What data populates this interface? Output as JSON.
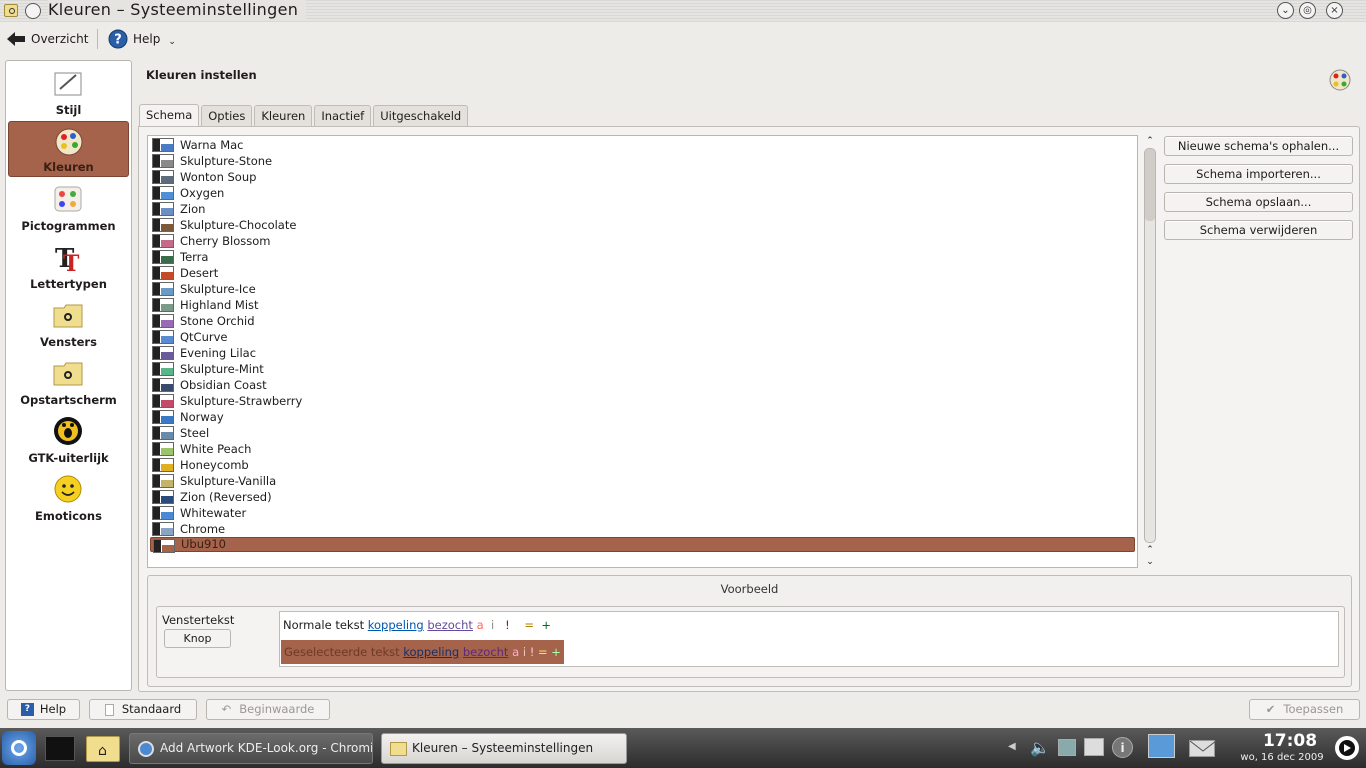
{
  "window": {
    "title": "Kleuren – Systeeminstellingen"
  },
  "toolbar": {
    "overview_label": "Overzicht",
    "help_label": "Help"
  },
  "sidebar": {
    "items": [
      {
        "label": "Stijl",
        "icon": "style-icon"
      },
      {
        "label": "Kleuren",
        "icon": "colors-icon"
      },
      {
        "label": "Pictogrammen",
        "icon": "icons-icon"
      },
      {
        "label": "Lettertypen",
        "icon": "fonts-icon"
      },
      {
        "label": "Vensters",
        "icon": "windows-folder-icon"
      },
      {
        "label": "Opstartscherm",
        "icon": "splash-folder-icon"
      },
      {
        "label": "GTK-uiterlijk",
        "icon": "gtk-icon"
      },
      {
        "label": "Emoticons",
        "icon": "emoticon-icon"
      }
    ],
    "selected": "Kleuren"
  },
  "main": {
    "title": "Kleuren instellen",
    "tabs": [
      "Schema",
      "Opties",
      "Kleuren",
      "Inactief",
      "Uitgeschakeld"
    ],
    "active_tab": "Schema",
    "schemes": [
      {
        "name": "Warna Mac",
        "color": "#4a7bc4"
      },
      {
        "name": "Skulpture-Stone",
        "color": "#8a8a8a"
      },
      {
        "name": "Wonton Soup",
        "color": "#5e6b7a"
      },
      {
        "name": "Oxygen",
        "color": "#4f8fd6"
      },
      {
        "name": "Zion",
        "color": "#6b8fc2"
      },
      {
        "name": "Skulpture-Chocolate",
        "color": "#7a5a3a"
      },
      {
        "name": "Cherry Blossom",
        "color": "#c46b8a"
      },
      {
        "name": "Terra",
        "color": "#3a6b4a"
      },
      {
        "name": "Desert",
        "color": "#c44a2a"
      },
      {
        "name": "Skulpture-Ice",
        "color": "#6a9ac4"
      },
      {
        "name": "Highland Mist",
        "color": "#7a9a8a"
      },
      {
        "name": "Stone Orchid",
        "color": "#9a6ab4"
      },
      {
        "name": "QtCurve",
        "color": "#5a8ad0"
      },
      {
        "name": "Evening Lilac",
        "color": "#6a5a9a"
      },
      {
        "name": "Skulpture-Mint",
        "color": "#5ab48a"
      },
      {
        "name": "Obsidian Coast",
        "color": "#3a4a6a"
      },
      {
        "name": "Skulpture-Strawberry",
        "color": "#c44a6a"
      },
      {
        "name": "Norway",
        "color": "#3a7ac4"
      },
      {
        "name": "Steel",
        "color": "#6a8aaa"
      },
      {
        "name": "White Peach",
        "color": "#9ac46a"
      },
      {
        "name": "Honeycomb",
        "color": "#e0b020"
      },
      {
        "name": "Skulpture-Vanilla",
        "color": "#c4b46a"
      },
      {
        "name": "Zion (Reversed)",
        "color": "#2a4a7a"
      },
      {
        "name": "Whitewater",
        "color": "#4a8ad4"
      },
      {
        "name": "Chrome",
        "color": "#8aa4c4"
      },
      {
        "name": "Ubu910",
        "color": "#a4634a"
      }
    ],
    "selected_scheme": "Ubu910",
    "buttons": {
      "get_new": "Nieuwe schema's ophalen...",
      "import": "Schema importeren...",
      "save": "Schema opslaan...",
      "remove": "Schema verwijderen"
    },
    "preview": {
      "title": "Voorbeeld",
      "window_text": "Venstertekst",
      "button_label": "Knop",
      "normal_text": "Normale tekst",
      "selected_text": "Geselecteerde tekst",
      "link": "koppeling",
      "visited": "bezocht",
      "active": "a",
      "inactive": "i",
      "negative": "!",
      "neutral": "=",
      "positive": "+"
    }
  },
  "footer": {
    "help": "Help",
    "defaults": "Standaard",
    "reset": "Beginwaarde",
    "apply": "Toepassen"
  },
  "taskbar": {
    "tasks": [
      {
        "label": "Add Artwork KDE-Look.org - Chromium",
        "active": false
      },
      {
        "label": "Kleuren – Systeeminstellingen",
        "active": true
      }
    ],
    "time": "17:08",
    "date": "wo, 16 dec 2009"
  }
}
